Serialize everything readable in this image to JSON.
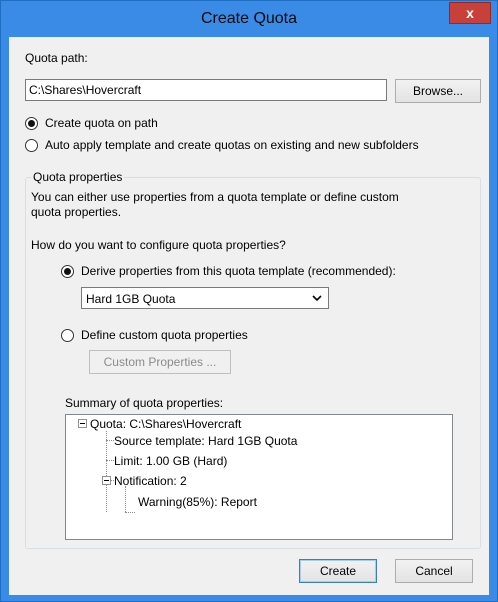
{
  "window": {
    "title": "Create Quota",
    "close_glyph": "x"
  },
  "quota_path": {
    "label": "Quota path:",
    "value": "C:\\Shares\\Hovercraft",
    "browse_label": "Browse..."
  },
  "scope": {
    "create_on_path_label": "Create quota on path",
    "auto_apply_label": "Auto apply template and create quotas on existing and new subfolders",
    "selected": "create_on_path"
  },
  "properties": {
    "group_title": "Quota properties",
    "description": "You can either use properties from a quota template or define custom quota properties.",
    "question": "How do you want to configure quota properties?",
    "derive_label": "Derive properties from this quota template (recommended):",
    "template_selected": "Hard 1GB Quota",
    "custom_label": "Define custom quota properties",
    "custom_button_label": "Custom Properties ...",
    "selected": "derive"
  },
  "summary": {
    "label": "Summary of quota properties:",
    "root": "Quota: C:\\Shares\\Hovercraft",
    "source_template": "Source template: Hard 1GB Quota",
    "limit": "Limit: 1.00 GB (Hard)",
    "notification": "Notification: 2",
    "warning": "Warning(85%): Report"
  },
  "footer": {
    "create_label": "Create",
    "cancel_label": "Cancel"
  },
  "colors": {
    "title_bar": "#3a8be6",
    "close_button": "#c7403a",
    "client_background": "#f0f0f0"
  }
}
